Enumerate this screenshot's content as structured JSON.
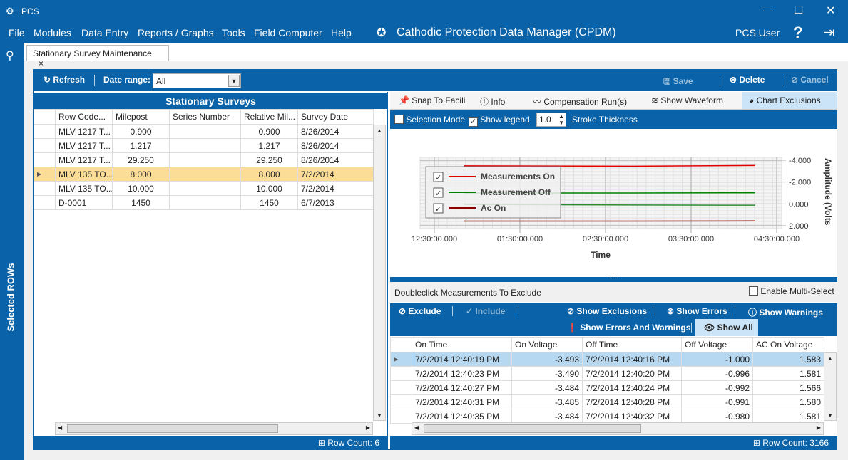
{
  "window": {
    "title": "PCS",
    "app_title": "Cathodic Protection Data Manager (CPDM)",
    "user": "PCS User"
  },
  "menu": [
    "File",
    "Modules",
    "Data Entry",
    "Reports / Graphs",
    "Tools",
    "Field Computer",
    "Help"
  ],
  "sidebar": {
    "label": "Selected ROWs"
  },
  "tab": {
    "label": "Stationary Survey Maintenance"
  },
  "toolbar": {
    "refresh": "Refresh",
    "date_range_label": "Date range:",
    "date_range_value": "All",
    "save": "Save",
    "delete": "Delete",
    "cancel": "Cancel"
  },
  "surveys": {
    "title": "Stationary Surveys",
    "columns": [
      "Row Code...",
      "Milepost",
      "Series Number",
      "Relative Mil...",
      "Survey Date"
    ],
    "rows": [
      [
        "MLV 1217 T...",
        "0.900",
        "",
        "0.900",
        "8/26/2014"
      ],
      [
        "MLV 1217 T...",
        "1.217",
        "",
        "1.217",
        "8/26/2014"
      ],
      [
        "MLV 1217 T...",
        "29.250",
        "",
        "29.250",
        "8/26/2014"
      ],
      [
        "MLV 135 TO...",
        "8.000",
        "",
        "8.000",
        "7/2/2014"
      ],
      [
        "MLV 135 TO...",
        "10.000",
        "",
        "10.000",
        "7/2/2014"
      ],
      [
        "D-0001",
        "1450",
        "",
        "1450",
        "6/7/2013"
      ]
    ],
    "selected_row": 3,
    "row_count_label": "Row Count:",
    "row_count": "6"
  },
  "chart_toolbar": {
    "snap": "Snap To Facili",
    "info": "Info",
    "comp": "Compensation Run(s)",
    "waveform": "Show Waveform",
    "exclusions": "Chart Exclusions",
    "selection_mode": "Selection Mode",
    "show_legend": "Show legend",
    "stroke_value": "1.0",
    "stroke_label": "Stroke Thickness"
  },
  "chart_data": {
    "type": "line",
    "xlabel": "Time",
    "ylabel": "Amplitude (Volts",
    "x_ticks": [
      "12:30:00.000",
      "01:30:00.000",
      "02:30:00.000",
      "03:30:00.000",
      "04:30:00.000"
    ],
    "y_ticks": [
      "-4.000",
      "-2.000",
      "0.000",
      "2.000"
    ],
    "ylim": [
      2,
      -4
    ],
    "grid": true,
    "legend": "top-left",
    "series": [
      {
        "name": "Measurements On",
        "color": "#e00000",
        "x": [
          "12:51",
          "02:50",
          "04:15"
        ],
        "values": [
          -3.49,
          -3.45,
          -3.52
        ]
      },
      {
        "name": "Measurement Off",
        "color": "#008000",
        "x": [
          "12:51",
          "02:50",
          "04:15"
        ],
        "values": [
          -1.0,
          -1.0,
          -1.02
        ]
      },
      {
        "color": "#2e8b2e",
        "x": [
          "12:51",
          "02:50",
          "04:15"
        ],
        "values": [
          0.05,
          0.1,
          0.12
        ]
      },
      {
        "name": "Ac On",
        "color": "#8b0000",
        "x": [
          "12:51",
          "02:50",
          "04:15"
        ],
        "values": [
          1.58,
          1.58,
          1.56
        ]
      }
    ]
  },
  "measurements": {
    "hint": "Doubleclick Measurements To Exclude",
    "multi_select": "Enable Multi-Select",
    "buttons": {
      "exclude": "Exclude",
      "include": "Include",
      "show_exclusions": "Show Exclusions",
      "show_errors": "Show Errors",
      "show_warnings": "Show Warnings",
      "show_errors_warnings": "Show Errors And Warnings",
      "show_all": "Show All"
    },
    "columns": [
      "On Time",
      "On Voltage",
      "Off Time",
      "Off Voltage",
      "AC On Voltage"
    ],
    "rows": [
      [
        "7/2/2014 12:40:19 PM",
        "-3.493",
        "7/2/2014 12:40:16 PM",
        "-1.000",
        "1.583"
      ],
      [
        "7/2/2014 12:40:23 PM",
        "-3.490",
        "7/2/2014 12:40:20 PM",
        "-0.996",
        "1.581"
      ],
      [
        "7/2/2014 12:40:27 PM",
        "-3.484",
        "7/2/2014 12:40:24 PM",
        "-0.992",
        "1.566"
      ],
      [
        "7/2/2014 12:40:31 PM",
        "-3.485",
        "7/2/2014 12:40:28 PM",
        "-0.991",
        "1.580"
      ],
      [
        "7/2/2014 12:40:35 PM",
        "-3.484",
        "7/2/2014 12:40:32 PM",
        "-0.980",
        "1.581"
      ]
    ],
    "row_count_label": "Row Count:",
    "row_count": "3166"
  }
}
